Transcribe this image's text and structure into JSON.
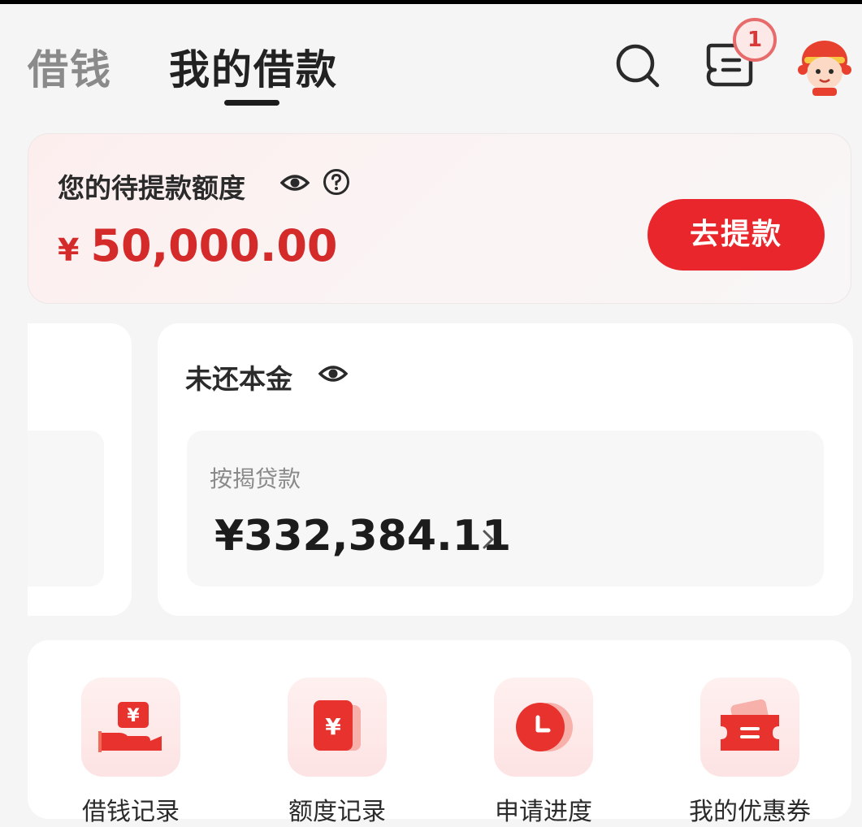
{
  "header": {
    "tabs": [
      {
        "label": "借钱",
        "active": false
      },
      {
        "label": "我的借款",
        "active": true
      }
    ],
    "message_badge_count": "1",
    "icons": [
      "search-icon",
      "message-list-icon",
      "mascot-avatar-icon"
    ]
  },
  "quota": {
    "title": "您的待提款额度",
    "currency": "¥",
    "amount": "50,000.00",
    "button_label": "去提款"
  },
  "principal": {
    "title": "未还本金",
    "loan_type": "按揭贷款",
    "amount": "¥332,384.11"
  },
  "functions": [
    {
      "label": "借钱记录",
      "icon": "hand-yuan-icon"
    },
    {
      "label": "额度记录",
      "icon": "yuan-card-icon"
    },
    {
      "label": "申请进度",
      "icon": "clock-icon"
    },
    {
      "label": "我的优惠券",
      "icon": "coupon-icon"
    }
  ],
  "colors": {
    "accent": "#e8262b",
    "amount_red": "#d42a2a",
    "background": "#f5f5f5"
  }
}
